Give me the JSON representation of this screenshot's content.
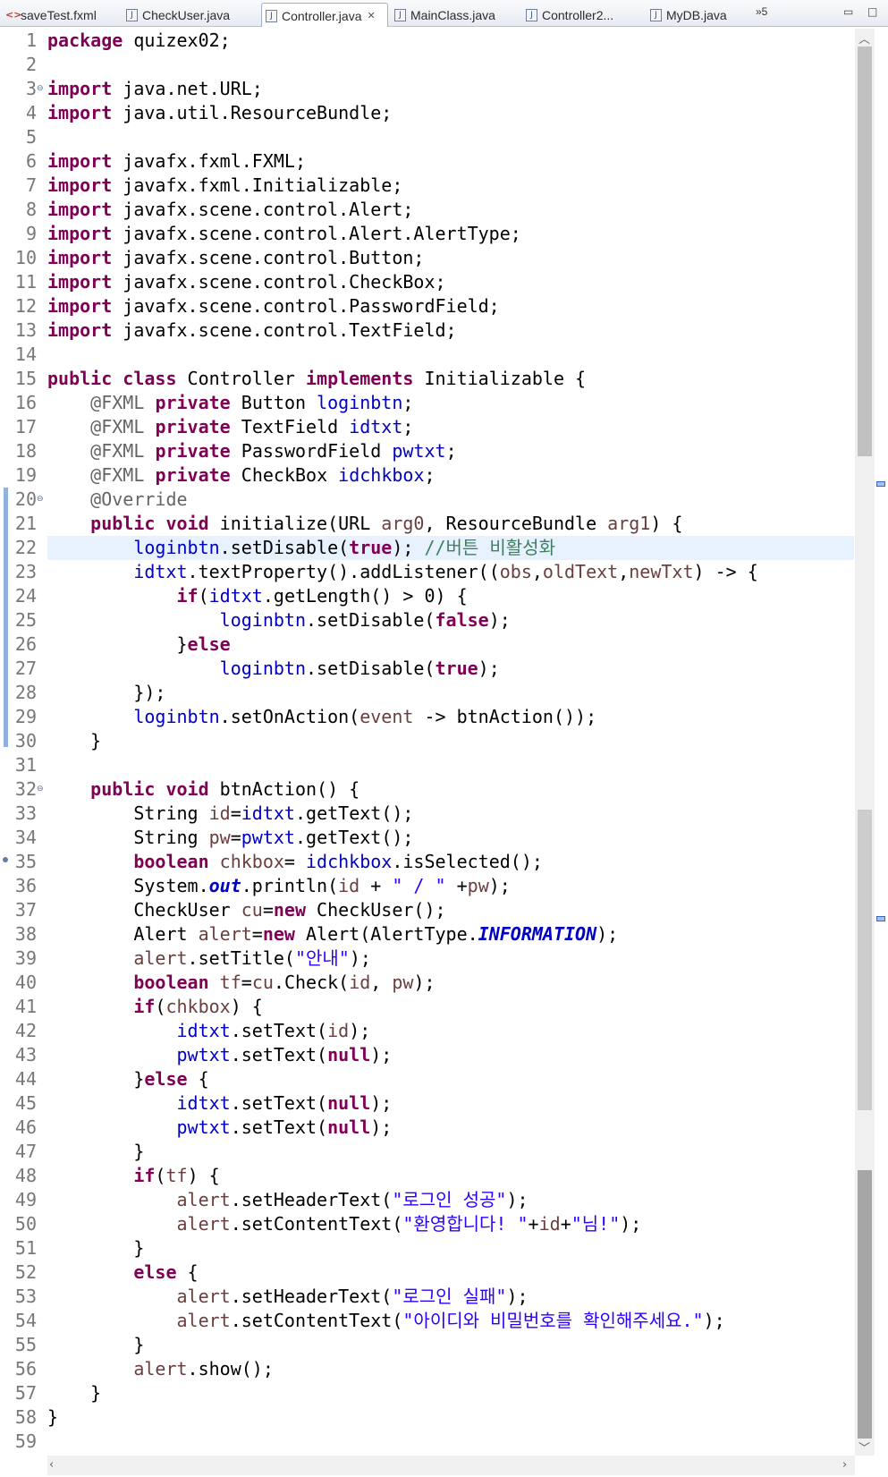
{
  "tabs": [
    {
      "label": "saveTest.fxml",
      "icon": "fxml-file-icon",
      "active": false
    },
    {
      "label": "CheckUser.java",
      "icon": "java-file-icon",
      "active": false
    },
    {
      "label": "Controller.java",
      "icon": "java-file-icon",
      "active": true
    },
    {
      "label": "MainClass.java",
      "icon": "java-file-icon",
      "active": false
    },
    {
      "label": "Controller2...",
      "icon": "java-file-icon",
      "active": false
    },
    {
      "label": "MyDB.java",
      "icon": "java-file-icon",
      "active": false
    }
  ],
  "tab_overflow": "»5",
  "editor": {
    "current_line": 22,
    "lines": [
      {
        "n": "1",
        "t": [
          [
            "kw",
            "package"
          ],
          [
            "pln",
            " quizex02;"
          ]
        ]
      },
      {
        "n": "2",
        "t": []
      },
      {
        "n": "3",
        "fold": "⊖",
        "t": [
          [
            "kw",
            "import"
          ],
          [
            "pln",
            " java.net.URL;"
          ]
        ]
      },
      {
        "n": "4",
        "t": [
          [
            "kw",
            "import"
          ],
          [
            "pln",
            " java.util.ResourceBundle;"
          ]
        ]
      },
      {
        "n": "5",
        "t": []
      },
      {
        "n": "6",
        "t": [
          [
            "kw",
            "import"
          ],
          [
            "pln",
            " javafx.fxml.FXML;"
          ]
        ]
      },
      {
        "n": "7",
        "t": [
          [
            "kw",
            "import"
          ],
          [
            "pln",
            " javafx.fxml.Initializable;"
          ]
        ]
      },
      {
        "n": "8",
        "t": [
          [
            "kw",
            "import"
          ],
          [
            "pln",
            " javafx.scene.control.Alert;"
          ]
        ]
      },
      {
        "n": "9",
        "t": [
          [
            "kw",
            "import"
          ],
          [
            "pln",
            " javafx.scene.control.Alert.AlertType;"
          ]
        ]
      },
      {
        "n": "10",
        "t": [
          [
            "kw",
            "import"
          ],
          [
            "pln",
            " javafx.scene.control.Button;"
          ]
        ]
      },
      {
        "n": "11",
        "t": [
          [
            "kw",
            "import"
          ],
          [
            "pln",
            " javafx.scene.control.CheckBox;"
          ]
        ]
      },
      {
        "n": "12",
        "t": [
          [
            "kw",
            "import"
          ],
          [
            "pln",
            " javafx.scene.control.PasswordField;"
          ]
        ]
      },
      {
        "n": "13",
        "t": [
          [
            "kw",
            "import"
          ],
          [
            "pln",
            " javafx.scene.control.TextField;"
          ]
        ]
      },
      {
        "n": "14",
        "t": []
      },
      {
        "n": "15",
        "t": [
          [
            "kw",
            "public"
          ],
          [
            "pln",
            " "
          ],
          [
            "kw",
            "class"
          ],
          [
            "pln",
            " Controller "
          ],
          [
            "kw",
            "implements"
          ],
          [
            "pln",
            " Initializable {"
          ]
        ]
      },
      {
        "n": "16",
        "t": [
          [
            "pln",
            "    "
          ],
          [
            "ann",
            "@FXML"
          ],
          [
            "pln",
            " "
          ],
          [
            "kw",
            "private"
          ],
          [
            "pln",
            " Button "
          ],
          [
            "fld",
            "loginbtn"
          ],
          [
            "pln",
            ";"
          ]
        ]
      },
      {
        "n": "17",
        "t": [
          [
            "pln",
            "    "
          ],
          [
            "ann",
            "@FXML"
          ],
          [
            "pln",
            " "
          ],
          [
            "kw",
            "private"
          ],
          [
            "pln",
            " TextField "
          ],
          [
            "fld",
            "idtxt"
          ],
          [
            "pln",
            ";"
          ]
        ]
      },
      {
        "n": "18",
        "t": [
          [
            "pln",
            "    "
          ],
          [
            "ann",
            "@FXML"
          ],
          [
            "pln",
            " "
          ],
          [
            "kw",
            "private"
          ],
          [
            "pln",
            " PasswordField "
          ],
          [
            "fld",
            "pwtxt"
          ],
          [
            "pln",
            ";"
          ]
        ]
      },
      {
        "n": "19",
        "t": [
          [
            "pln",
            "    "
          ],
          [
            "ann",
            "@FXML"
          ],
          [
            "pln",
            " "
          ],
          [
            "kw",
            "private"
          ],
          [
            "pln",
            " CheckBox "
          ],
          [
            "fld",
            "idchkbox"
          ],
          [
            "pln",
            ";"
          ]
        ]
      },
      {
        "n": "20",
        "fold": "⊖",
        "t": [
          [
            "pln",
            "    "
          ],
          [
            "ann",
            "@Override"
          ]
        ]
      },
      {
        "n": "21",
        "t": [
          [
            "pln",
            "    "
          ],
          [
            "kw",
            "public"
          ],
          [
            "pln",
            " "
          ],
          [
            "kw",
            "void"
          ],
          [
            "pln",
            " initialize(URL "
          ],
          [
            "loc",
            "arg0"
          ],
          [
            "pln",
            ", ResourceBundle "
          ],
          [
            "loc",
            "arg1"
          ],
          [
            "pln",
            ") {"
          ]
        ]
      },
      {
        "n": "22",
        "t": [
          [
            "pln",
            "        "
          ],
          [
            "fld",
            "loginbtn"
          ],
          [
            "pln",
            ".setDisable("
          ],
          [
            "kw",
            "true"
          ],
          [
            "pln",
            "); "
          ],
          [
            "cmt",
            "//버튼 비활성화"
          ]
        ]
      },
      {
        "n": "23",
        "t": [
          [
            "pln",
            "        "
          ],
          [
            "fld",
            "idtxt"
          ],
          [
            "pln",
            ".textProperty().addListener(("
          ],
          [
            "loc",
            "obs"
          ],
          [
            "pln",
            ","
          ],
          [
            "loc",
            "oldText"
          ],
          [
            "pln",
            ","
          ],
          [
            "loc",
            "newTxt"
          ],
          [
            "pln",
            ") -> {"
          ]
        ]
      },
      {
        "n": "24",
        "t": [
          [
            "pln",
            "            "
          ],
          [
            "kw",
            "if"
          ],
          [
            "pln",
            "("
          ],
          [
            "fld",
            "idtxt"
          ],
          [
            "pln",
            ".getLength() > 0) {"
          ]
        ]
      },
      {
        "n": "25",
        "t": [
          [
            "pln",
            "                "
          ],
          [
            "fld",
            "loginbtn"
          ],
          [
            "pln",
            ".setDisable("
          ],
          [
            "kw",
            "false"
          ],
          [
            "pln",
            ");"
          ]
        ]
      },
      {
        "n": "26",
        "t": [
          [
            "pln",
            "            }"
          ],
          [
            "kw",
            "else"
          ]
        ]
      },
      {
        "n": "27",
        "t": [
          [
            "pln",
            "                "
          ],
          [
            "fld",
            "loginbtn"
          ],
          [
            "pln",
            ".setDisable("
          ],
          [
            "kw",
            "true"
          ],
          [
            "pln",
            ");"
          ]
        ]
      },
      {
        "n": "28",
        "t": [
          [
            "pln",
            "        });"
          ]
        ]
      },
      {
        "n": "29",
        "t": [
          [
            "pln",
            "        "
          ],
          [
            "fld",
            "loginbtn"
          ],
          [
            "pln",
            ".setOnAction("
          ],
          [
            "loc",
            "event"
          ],
          [
            "pln",
            " -> btnAction());"
          ]
        ]
      },
      {
        "n": "30",
        "t": [
          [
            "pln",
            "    }"
          ]
        ]
      },
      {
        "n": "31",
        "t": []
      },
      {
        "n": "32",
        "fold": "⊖",
        "t": [
          [
            "pln",
            "    "
          ],
          [
            "kw",
            "public"
          ],
          [
            "pln",
            " "
          ],
          [
            "kw",
            "void"
          ],
          [
            "pln",
            " btnAction() {"
          ]
        ]
      },
      {
        "n": "33",
        "t": [
          [
            "pln",
            "        String "
          ],
          [
            "loc",
            "id"
          ],
          [
            "pln",
            "="
          ],
          [
            "fld",
            "idtxt"
          ],
          [
            "pln",
            ".getText();"
          ]
        ]
      },
      {
        "n": "34",
        "t": [
          [
            "pln",
            "        String "
          ],
          [
            "loc",
            "pw"
          ],
          [
            "pln",
            "="
          ],
          [
            "fld",
            "pwtxt"
          ],
          [
            "pln",
            ".getText();"
          ]
        ]
      },
      {
        "n": "35",
        "t": [
          [
            "pln",
            "        "
          ],
          [
            "kw",
            "boolean"
          ],
          [
            "pln",
            " "
          ],
          [
            "loc",
            "chkbox"
          ],
          [
            "pln",
            "= "
          ],
          [
            "fld",
            "idchkbox"
          ],
          [
            "pln",
            ".isSelected();"
          ]
        ]
      },
      {
        "n": "36",
        "t": [
          [
            "pln",
            "        System."
          ],
          [
            "sfld",
            "out"
          ],
          [
            "pln",
            ".println("
          ],
          [
            "loc",
            "id"
          ],
          [
            "pln",
            " + "
          ],
          [
            "str",
            "\" / \""
          ],
          [
            "pln",
            " +"
          ],
          [
            "loc",
            "pw"
          ],
          [
            "pln",
            ");"
          ]
        ]
      },
      {
        "n": "37",
        "t": [
          [
            "pln",
            "        CheckUser "
          ],
          [
            "loc",
            "cu"
          ],
          [
            "pln",
            "="
          ],
          [
            "kw",
            "new"
          ],
          [
            "pln",
            " CheckUser();"
          ]
        ]
      },
      {
        "n": "38",
        "t": [
          [
            "pln",
            "        Alert "
          ],
          [
            "loc",
            "alert"
          ],
          [
            "pln",
            "="
          ],
          [
            "kw",
            "new"
          ],
          [
            "pln",
            " Alert(AlertType."
          ],
          [
            "sfld",
            "INFORMATION"
          ],
          [
            "pln",
            ");"
          ]
        ]
      },
      {
        "n": "39",
        "t": [
          [
            "pln",
            "        "
          ],
          [
            "loc",
            "alert"
          ],
          [
            "pln",
            ".setTitle("
          ],
          [
            "str",
            "\"안내\""
          ],
          [
            "pln",
            ");"
          ]
        ]
      },
      {
        "n": "40",
        "t": [
          [
            "pln",
            "        "
          ],
          [
            "kw",
            "boolean"
          ],
          [
            "pln",
            " "
          ],
          [
            "loc",
            "tf"
          ],
          [
            "pln",
            "="
          ],
          [
            "loc",
            "cu"
          ],
          [
            "pln",
            ".Check("
          ],
          [
            "loc",
            "id"
          ],
          [
            "pln",
            ", "
          ],
          [
            "loc",
            "pw"
          ],
          [
            "pln",
            ");"
          ]
        ]
      },
      {
        "n": "41",
        "t": [
          [
            "pln",
            "        "
          ],
          [
            "kw",
            "if"
          ],
          [
            "pln",
            "("
          ],
          [
            "loc",
            "chkbox"
          ],
          [
            "pln",
            ") {"
          ]
        ]
      },
      {
        "n": "42",
        "t": [
          [
            "pln",
            "            "
          ],
          [
            "fld",
            "idtxt"
          ],
          [
            "pln",
            ".setText("
          ],
          [
            "loc",
            "id"
          ],
          [
            "pln",
            ");"
          ]
        ]
      },
      {
        "n": "43",
        "t": [
          [
            "pln",
            "            "
          ],
          [
            "fld",
            "pwtxt"
          ],
          [
            "pln",
            ".setText("
          ],
          [
            "kw",
            "null"
          ],
          [
            "pln",
            ");"
          ]
        ]
      },
      {
        "n": "44",
        "t": [
          [
            "pln",
            "        }"
          ],
          [
            "kw",
            "else"
          ],
          [
            "pln",
            " {"
          ]
        ]
      },
      {
        "n": "45",
        "t": [
          [
            "pln",
            "            "
          ],
          [
            "fld",
            "idtxt"
          ],
          [
            "pln",
            ".setText("
          ],
          [
            "kw",
            "null"
          ],
          [
            "pln",
            ");"
          ]
        ]
      },
      {
        "n": "46",
        "t": [
          [
            "pln",
            "            "
          ],
          [
            "fld",
            "pwtxt"
          ],
          [
            "pln",
            ".setText("
          ],
          [
            "kw",
            "null"
          ],
          [
            "pln",
            ");"
          ]
        ]
      },
      {
        "n": "47",
        "t": [
          [
            "pln",
            "        }"
          ]
        ]
      },
      {
        "n": "48",
        "t": [
          [
            "pln",
            "        "
          ],
          [
            "kw",
            "if"
          ],
          [
            "pln",
            "("
          ],
          [
            "loc",
            "tf"
          ],
          [
            "pln",
            ") {"
          ]
        ]
      },
      {
        "n": "49",
        "t": [
          [
            "pln",
            "            "
          ],
          [
            "loc",
            "alert"
          ],
          [
            "pln",
            ".setHeaderText("
          ],
          [
            "str",
            "\"로그인 성공\""
          ],
          [
            "pln",
            ");"
          ]
        ]
      },
      {
        "n": "50",
        "t": [
          [
            "pln",
            "            "
          ],
          [
            "loc",
            "alert"
          ],
          [
            "pln",
            ".setContentText("
          ],
          [
            "str",
            "\"환영합니다! \""
          ],
          [
            "pln",
            "+"
          ],
          [
            "loc",
            "id"
          ],
          [
            "pln",
            "+"
          ],
          [
            "str",
            "\"님!\""
          ],
          [
            "pln",
            ");"
          ]
        ]
      },
      {
        "n": "51",
        "t": [
          [
            "pln",
            "        }"
          ]
        ]
      },
      {
        "n": "52",
        "t": [
          [
            "pln",
            "        "
          ],
          [
            "kw",
            "else"
          ],
          [
            "pln",
            " {"
          ]
        ]
      },
      {
        "n": "53",
        "t": [
          [
            "pln",
            "            "
          ],
          [
            "loc",
            "alert"
          ],
          [
            "pln",
            ".setHeaderText("
          ],
          [
            "str",
            "\"로그인 실패\""
          ],
          [
            "pln",
            ");"
          ]
        ]
      },
      {
        "n": "54",
        "t": [
          [
            "pln",
            "            "
          ],
          [
            "loc",
            "alert"
          ],
          [
            "pln",
            ".setContentText("
          ],
          [
            "str",
            "\"아이디와 비밀번호를 확인해주세요.\""
          ],
          [
            "pln",
            ");"
          ]
        ]
      },
      {
        "n": "55",
        "t": [
          [
            "pln",
            "        }"
          ]
        ]
      },
      {
        "n": "56",
        "t": [
          [
            "pln",
            "        "
          ],
          [
            "loc",
            "alert"
          ],
          [
            "pln",
            ".show();"
          ]
        ]
      },
      {
        "n": "57",
        "t": [
          [
            "pln",
            "    }"
          ]
        ]
      },
      {
        "n": "58",
        "t": [
          [
            "pln",
            "}"
          ]
        ]
      },
      {
        "n": "59",
        "t": []
      }
    ]
  },
  "colors": {
    "keyword": "#7f0055",
    "field": "#0000c0",
    "string": "#2a00ff",
    "comment": "#3f7f5f",
    "annotation": "#646464",
    "local_variable": "#6a3e3e",
    "line_number": "#787878",
    "current_line_highlight": "#e8f2fe"
  }
}
